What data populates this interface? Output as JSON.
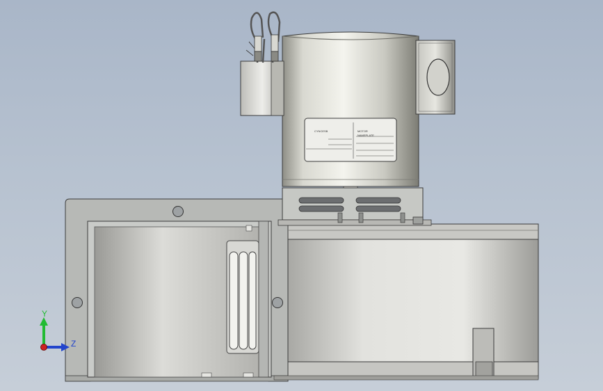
{
  "viewport": {
    "background_top": "#a9b6c8",
    "background_bottom": "#c6ced8"
  },
  "triad": {
    "y_label": "Y",
    "z_label": "Z",
    "y_color": "#22bb33",
    "z_color": "#2244cc",
    "x_color": "#cc2222"
  },
  "nameplate": {
    "lines": [
      "CYNCESB",
      "MOTOR",
      "NAMEPLATE"
    ]
  },
  "model": {
    "motor_color": "#c8c8c0",
    "housing_color": "#d6d6d2",
    "bracket_color": "#b9bbb8"
  }
}
